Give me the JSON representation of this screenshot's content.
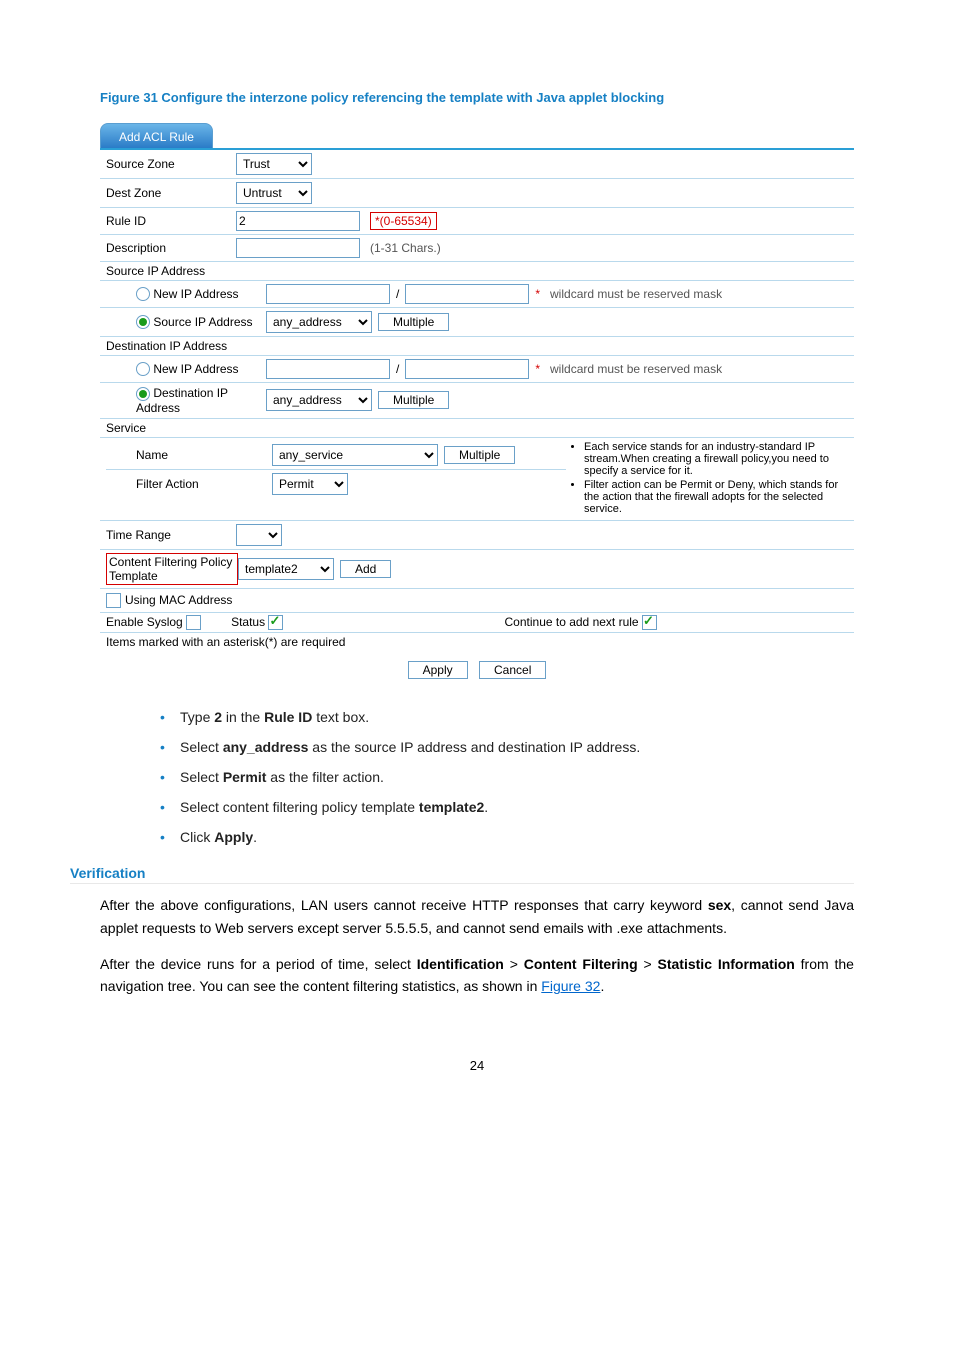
{
  "figure_caption": "Figure 31 Configure the interzone policy referencing the template with Java applet blocking",
  "tab_title": "Add ACL Rule",
  "form": {
    "source_zone": {
      "label": "Source Zone",
      "value": "Trust"
    },
    "dest_zone": {
      "label": "Dest Zone",
      "value": "Untrust"
    },
    "rule_id": {
      "label": "Rule ID",
      "value": "2",
      "hint": "*(0-65534)"
    },
    "description": {
      "label": "Description",
      "value": "",
      "hint": "(1-31 Chars.)"
    },
    "source_ip_header": "Source IP Address",
    "src_new_ip": {
      "label": "New IP Address",
      "slash": "/",
      "hint": "wildcard must be reserved mask"
    },
    "src_ip": {
      "label": "Source IP Address",
      "value": "any_address",
      "multiple": "Multiple"
    },
    "dest_ip_header": "Destination IP Address",
    "dst_new_ip": {
      "label": "New IP Address",
      "slash": "/",
      "hint": "wildcard must be reserved mask"
    },
    "dst_ip": {
      "label": "Destination IP Address",
      "value": "any_address",
      "multiple": "Multiple"
    },
    "service_header": "Service",
    "service_name": {
      "label": "Name",
      "value": "any_service",
      "multiple": "Multiple"
    },
    "filter_action": {
      "label": "Filter Action",
      "value": "Permit"
    },
    "service_notes": [
      "Each service stands for an industry-standard IP stream.When creating a firewall policy,you need to specify a service for it.",
      "Filter action can be Permit or Deny, which stands for the action that the firewall adopts for the selected service."
    ],
    "time_range": {
      "label": "Time Range",
      "value": ""
    },
    "cf_template": {
      "label": "Content Filtering Policy Template",
      "value": "template2",
      "add": "Add"
    },
    "using_mac": {
      "label": "Using MAC Address"
    },
    "enable_syslog": {
      "label": "Enable Syslog"
    },
    "status_label": "Status",
    "continue_label": "Continue to add next rule",
    "required_note": "Items marked with an asterisk(*) are required",
    "apply": "Apply",
    "cancel": "Cancel"
  },
  "doc": {
    "bullets": [
      {
        "pre": "Type ",
        "b1": "2",
        "mid": " in the ",
        "b2": "Rule ID",
        "post": " text box."
      },
      {
        "pre": "Select ",
        "b1": "any_address",
        "post": " as the source IP address and destination IP address."
      },
      {
        "pre": "Select ",
        "b1": "Permit",
        "post": " as the filter action."
      },
      {
        "pre": "Select content filtering policy template ",
        "b1": "template2",
        "post": "."
      },
      {
        "pre": "Click ",
        "b1": "Apply",
        "post": "."
      }
    ],
    "verification_h": "Verification",
    "para1_a": "After the above configurations, LAN users cannot receive HTTP responses that carry keyword ",
    "para1_b": "sex",
    "para1_c": ", cannot send Java applet requests to Web servers except server 5.5.5.5, and cannot send emails with .exe attachments.",
    "para2_a": "After the device runs for a period of time, select ",
    "para2_b1": "Identification",
    "para2_gt": " > ",
    "para2_b2": "Content Filtering",
    "para2_b3": "Statistic Information",
    "para2_c": " from the navigation tree. You can see the content filtering statistics, as shown in ",
    "para2_link": "Figure 32",
    "para2_d": ".",
    "pagenum": "24"
  }
}
